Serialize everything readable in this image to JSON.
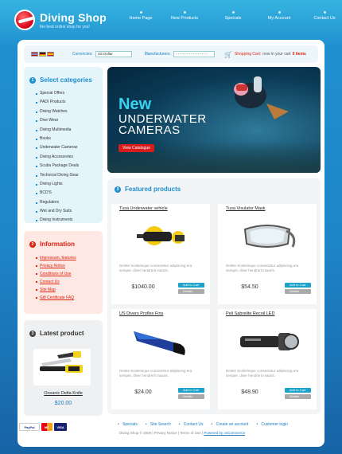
{
  "header": {
    "logo_title": "Diving Shop",
    "logo_tagline": "the best online shop for you!",
    "nav": [
      "Home Page",
      "New Products",
      "Specials",
      "My Account",
      "Contact Us"
    ]
  },
  "toolbar": {
    "currencies_label": "Currencies:",
    "currency_value": "US Dollar",
    "manufacturers_label": "Manufacturers:",
    "manufacturer_value": "- - - - - - - - - - - - - - -",
    "cart_label": "Shopping Cart:",
    "cart_text": "now in your cart",
    "cart_count": "0 items"
  },
  "categories": {
    "number": "1",
    "title": "Select categories",
    "items": [
      "Special Offers",
      "PADI Products",
      "Diving Watches",
      "Dive Wear",
      "Diving Multimedia",
      "Books",
      "Underwater Cameras",
      "Diving Accessories",
      "Scuba Package Deals",
      "Technical Diving Gear",
      "Diving Lights",
      "BCD'S",
      "Regulators",
      "Wet and Dry Suits",
      "Diving Instruments"
    ]
  },
  "information": {
    "number": "2",
    "title": "Information",
    "items": [
      "Impressum, features",
      "Privacy Notice",
      "Conditions of Use",
      "Contact Us",
      "Site Map",
      "Gift Certificate FAQ"
    ]
  },
  "latest": {
    "number": "3",
    "title": "Latest product",
    "product_name": "Oceanic Delta Knife",
    "price": "$20.00"
  },
  "banner": {
    "headline": "New",
    "subline1": "UNDERWATER",
    "subline2": "CAMERAS",
    "button": "View Catalogue"
  },
  "featured": {
    "number": "3",
    "title": "Featured products",
    "products": [
      {
        "name": "Tusa Underwater vehicle",
        "desc": "Delete Scelerisque consectetur adipiscing era semper, diver hendrerit mauris.",
        "price": "$1040.00",
        "add": "Add to Cart",
        "details": "Details"
      },
      {
        "name": "Tusa Visulator Mask",
        "desc": "Delete Scelerisque consectetur adipiscing era semper, diver hendrerit mauris.",
        "price": "$54.50",
        "add": "Add to Cart",
        "details": "Details"
      },
      {
        "name": "US Divers Proflex Fins",
        "desc": "Delete Scelerisque consectetur adipiscing era semper, diver hendrerit mauris.",
        "price": "$24.00",
        "add": "Add to Cart",
        "details": "Details"
      },
      {
        "name": "Peli Sabrelite Recoil LED",
        "desc": "Delete Scelerisque consectetur adipiscing era semper, diver hendrerit mauris.",
        "price": "$48.90",
        "add": "Add to Cart",
        "details": "Details"
      }
    ]
  },
  "footer": {
    "payments": [
      "PayPal",
      "MC",
      "VISA"
    ],
    "links": [
      "Specials",
      "Site Search",
      "Contact Us",
      "Create an account",
      "Customer login"
    ],
    "copyright": "Diving Shop © 2008",
    "privacy": "Privacy Notice",
    "terms": "Terms of Use",
    "powered": "Powered by osCommerce"
  },
  "colors": {
    "accent": "#1f8fcf",
    "red": "#d81c1c",
    "info_red": "#d21"
  }
}
